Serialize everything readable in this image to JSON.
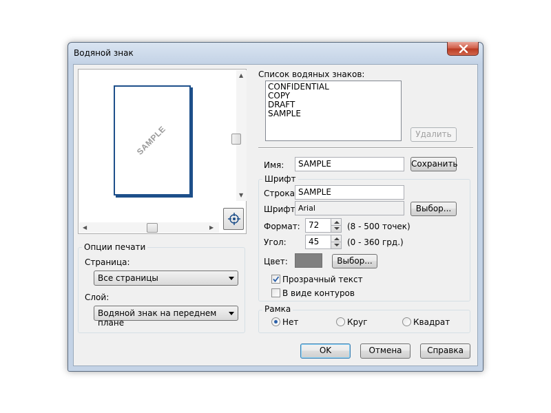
{
  "window": {
    "title": "Водяной знак",
    "close_icon": "close-icon"
  },
  "preview": {
    "watermark_text": "SAMPLE",
    "center_icon": "crosshair-icon"
  },
  "print_options": {
    "group_label": "Опции печати",
    "page_label": "Страница:",
    "page_value": "Все страницы",
    "layer_label": "Слой:",
    "layer_value": "Водяной знак на переднем плане"
  },
  "watermark_list": {
    "label": "Список водяных знаков:",
    "items": [
      "CONFIDENTIAL",
      "COPY",
      "DRAFT",
      "SAMPLE"
    ],
    "delete_label": "Удалить"
  },
  "name": {
    "label": "Имя:",
    "value": "SAMPLE",
    "save_label": "Сохранить"
  },
  "font": {
    "group_label": "Шрифт",
    "string_label": "Строка:",
    "string_value": "SAMPLE",
    "font_label": "Шрифт:",
    "font_value": "Arial",
    "font_choose_label": "Выбор...",
    "size_label": "Формат:",
    "size_value": "72",
    "size_range": "(8 - 500 точек)",
    "angle_label": "Угол:",
    "angle_value": "45",
    "angle_range": "(0 - 360 грд.)",
    "color_label": "Цвет:",
    "color_value": "#808080",
    "color_choose_label": "Выбор...",
    "transparent_label": "Прозрачный текст",
    "transparent_checked": true,
    "outline_label": "В виде контуров",
    "outline_checked": false
  },
  "frame": {
    "group_label": "Рамка",
    "options": [
      "Нет",
      "Круг",
      "Квадрат"
    ],
    "selected": "Нет"
  },
  "footer": {
    "ok_label": "OK",
    "cancel_label": "Отмена",
    "help_label": "Справка"
  }
}
